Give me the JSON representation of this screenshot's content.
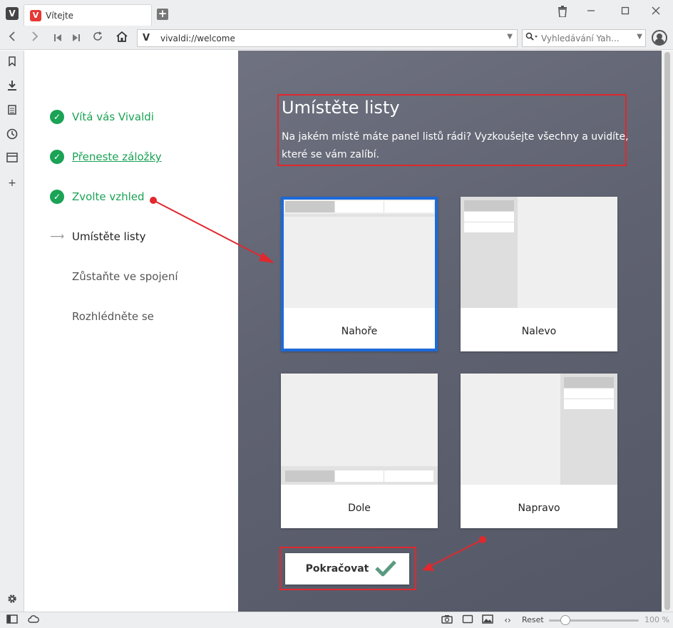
{
  "browser": {
    "tab_title": "Vítejte",
    "url": "vivaldi://welcome",
    "search_placeholder": "Vyhledávání Yah...",
    "zoom_reset_label": "Reset",
    "zoom_level": "100 %",
    "zoom_fraction": 0.14
  },
  "steps": [
    {
      "label": "Vítá vás Vivaldi",
      "state": "done"
    },
    {
      "label": "Přeneste záložky",
      "state": "done-link"
    },
    {
      "label": "Zvolte vzhled",
      "state": "done"
    },
    {
      "label": "Umístěte listy",
      "state": "current"
    },
    {
      "label": "Zůstaňte ve spojení",
      "state": "todo"
    },
    {
      "label": "Rozhlédněte se",
      "state": "todo"
    }
  ],
  "header": {
    "title": "Umístěte listy",
    "description": "Na jakém místě máte panel listů rádi? Vyzkoušejte všechny a uvidíte, které se vám zalíbí."
  },
  "options": [
    {
      "label": "Nahoře",
      "selected": true
    },
    {
      "label": "Nalevo",
      "selected": false
    },
    {
      "label": "Dole",
      "selected": false
    },
    {
      "label": "Napravo",
      "selected": false
    }
  ],
  "continue_label": "Pokračovat",
  "colors": {
    "accent_green": "#1aa355",
    "selection_blue": "#1c6ad8",
    "annotation_red": "#e0282e",
    "content_bg": "#5f6270"
  }
}
